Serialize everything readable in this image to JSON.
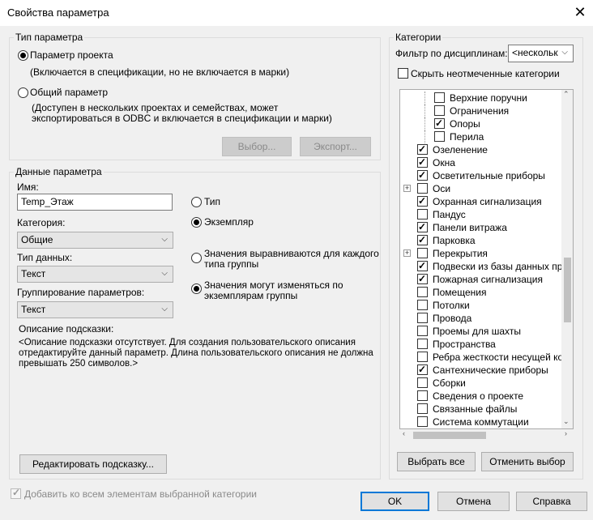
{
  "window": {
    "title": "Свойства параметра",
    "close_glyph": "✕"
  },
  "param_type": {
    "legend": "Тип параметра",
    "project_label": "Параметр проекта",
    "project_desc": "(Включается в спецификации, но не включается в марки)",
    "shared_label": "Общий параметр",
    "shared_desc_1": "(Доступен в нескольких проектах и семействах, может",
    "shared_desc_2": "экспортироваться в ODBC и включается в спецификации и марки)",
    "select_btn": "Выбор...",
    "export_btn": "Экспорт..."
  },
  "param_data": {
    "legend": "Данные параметра",
    "name_label": "Имя:",
    "name_value": "Temp_Этаж",
    "category_label": "Категория:",
    "category_value": "Общие",
    "datatype_label": "Тип данных:",
    "datatype_value": "Текст",
    "grouping_label": "Группирование параметров:",
    "grouping_value": "Текст",
    "type_label": "Тип",
    "instance_label": "Экземпляр",
    "align_label_1": "Значения выравниваются для каждого",
    "align_label_2": "типа группы",
    "vary_label_1": "Значения могут изменяться по",
    "vary_label_2": "экземплярам группы",
    "tooltip_label": "Описание подсказки:",
    "tooltip_1": "<Описание подсказки отсутствует. Для создания пользовательского описания",
    "tooltip_2": "отредактируйте данный параметр. Длина пользовательского описания не должна",
    "tooltip_3": "превышать 250 символов.>",
    "edit_tooltip_btn": "Редактировать подсказку..."
  },
  "categories": {
    "legend": "Категории",
    "filter_label": "Фильтр по дисциплинам:",
    "filter_value": "<нескольк",
    "hide_unchecked": "Скрыть неотмеченные категории",
    "items": [
      {
        "label": "Верхние поручни",
        "checked": false,
        "level": 2,
        "expand": false
      },
      {
        "label": "Ограничения",
        "checked": false,
        "level": 2,
        "expand": false
      },
      {
        "label": "Опоры",
        "checked": true,
        "level": 2,
        "expand": false
      },
      {
        "label": "Перила",
        "checked": false,
        "level": 2,
        "expand": false
      },
      {
        "label": "Озеленение",
        "checked": true,
        "level": 1,
        "expand": false
      },
      {
        "label": "Окна",
        "checked": true,
        "level": 1,
        "expand": false
      },
      {
        "label": "Осветительные приборы",
        "checked": true,
        "level": 1,
        "expand": false
      },
      {
        "label": "Оси",
        "checked": false,
        "level": 1,
        "expand": true
      },
      {
        "label": "Охранная сигнализация",
        "checked": true,
        "level": 1,
        "expand": false
      },
      {
        "label": "Пандус",
        "checked": false,
        "level": 1,
        "expand": false
      },
      {
        "label": "Панели витража",
        "checked": true,
        "level": 1,
        "expand": false
      },
      {
        "label": "Парковка",
        "checked": true,
        "level": 1,
        "expand": false
      },
      {
        "label": "Перекрытия",
        "checked": false,
        "level": 1,
        "expand": true
      },
      {
        "label": "Подвески из базы данных прои",
        "checked": true,
        "level": 1,
        "expand": false
      },
      {
        "label": "Пожарная сигнализация",
        "checked": true,
        "level": 1,
        "expand": false
      },
      {
        "label": "Помещения",
        "checked": false,
        "level": 1,
        "expand": false
      },
      {
        "label": "Потолки",
        "checked": false,
        "level": 1,
        "expand": false
      },
      {
        "label": "Провода",
        "checked": false,
        "level": 1,
        "expand": false
      },
      {
        "label": "Проемы для шахты",
        "checked": false,
        "level": 1,
        "expand": false
      },
      {
        "label": "Пространства",
        "checked": false,
        "level": 1,
        "expand": false
      },
      {
        "label": "Ребра жесткости несущей конс",
        "checked": false,
        "level": 1,
        "expand": false
      },
      {
        "label": "Сантехнические приборы",
        "checked": true,
        "level": 1,
        "expand": false
      },
      {
        "label": "Сборки",
        "checked": false,
        "level": 1,
        "expand": false
      },
      {
        "label": "Сведения о проекте",
        "checked": false,
        "level": 1,
        "expand": false
      },
      {
        "label": "Связанные файлы",
        "checked": false,
        "level": 1,
        "expand": false
      },
      {
        "label": "Система коммутации",
        "checked": false,
        "level": 1,
        "expand": false
      }
    ],
    "select_all_btn": "Выбрать все",
    "deselect_btn": "Отменить выбор"
  },
  "footer": {
    "add_all_label": "Добавить ко всем элементам выбранной категории",
    "ok_btn": "OK",
    "cancel_btn": "Отмена",
    "help_btn": "Справка"
  }
}
